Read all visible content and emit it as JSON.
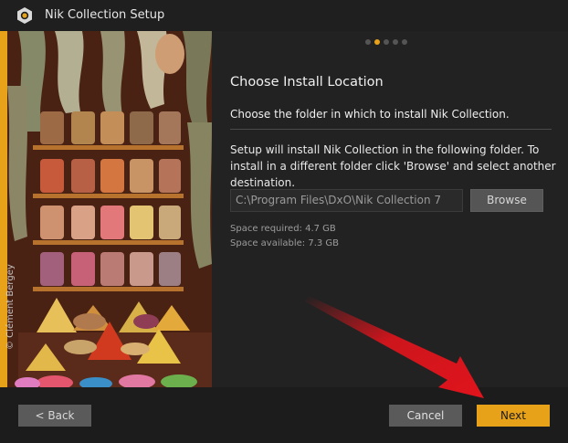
{
  "window": {
    "title": "Nik Collection Setup"
  },
  "side_panel": {
    "photo_credit": "© Clément Bergey"
  },
  "steps": {
    "total": 5,
    "current": 2
  },
  "content": {
    "heading": "Choose Install Location",
    "subheading": "Choose the folder in which to install Nik Collection.",
    "description": "Setup will install Nik Collection in the following folder. To install in a different folder click 'Browse' and select another destination.",
    "install_path": "C:\\Program Files\\DxO\\Nik Collection 7",
    "browse_label": "Browse",
    "space_required": "Space required: 4.7 GB",
    "space_available": "Space available: 7.3 GB"
  },
  "footer": {
    "back_label": "< Back",
    "cancel_label": "Cancel",
    "next_label": "Next"
  },
  "colors": {
    "accent": "#e8a21a",
    "background": "#222222",
    "annotation_arrow": "#e0141c"
  },
  "icons": {
    "app": "nik-logo-icon"
  }
}
